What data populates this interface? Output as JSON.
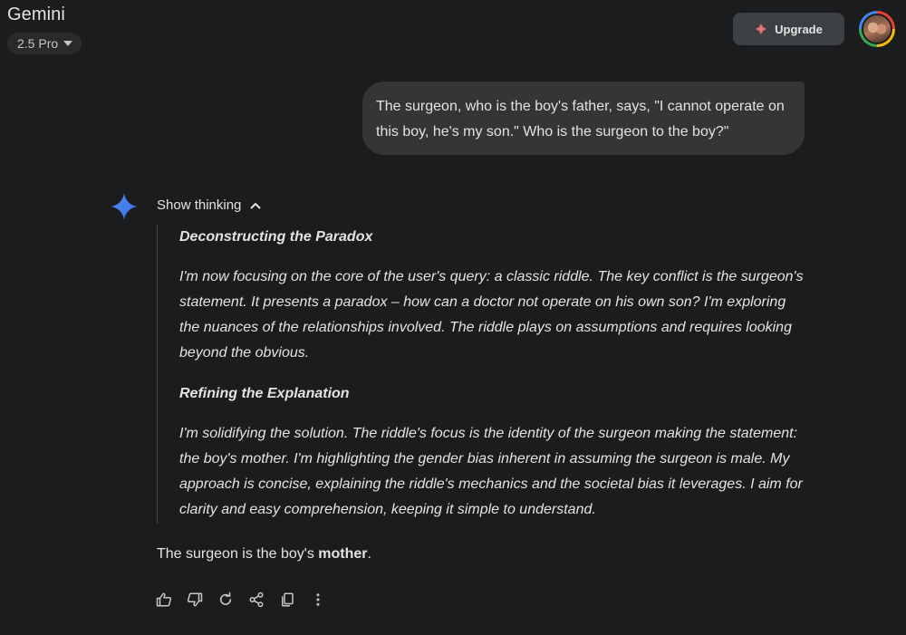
{
  "header": {
    "app_title": "Gemini",
    "model_label": "2.5 Pro",
    "upgrade_label": "Upgrade"
  },
  "user_message": {
    "text": "The surgeon, who is the boy's father, says, \"I cannot operate on this boy, he's my son.\" Who is the surgeon to the boy?\""
  },
  "response": {
    "show_thinking_label": "Show thinking",
    "thoughts": [
      {
        "heading": "Deconstructing the Paradox",
        "body": "I'm now focusing on the core of the user's query:  a classic riddle. The key conflict is the surgeon's statement. It presents a paradox – how can a doctor not operate on his own son? I'm exploring the nuances of the relationships involved. The riddle plays on assumptions and requires looking beyond the obvious."
      },
      {
        "heading": "Refining the Explanation",
        "body": "I'm solidifying the solution. The riddle's focus is the identity of the surgeon making the statement: the boy's mother. I'm highlighting the gender bias inherent in assuming the surgeon is male. My approach is concise, explaining the riddle's mechanics and the societal bias it leverages. I aim for clarity and easy comprehension, keeping it simple to understand."
      }
    ],
    "answer_prefix": "The surgeon is the boy's ",
    "answer_bold": "mother",
    "answer_suffix": "."
  },
  "actions": [
    "thumbs-up-icon",
    "thumbs-down-icon",
    "redo-icon",
    "share-icon",
    "copy-icon",
    "more-vert-icon"
  ],
  "colors": {
    "background": "#1b1c1d",
    "bubble": "#333537",
    "upgrade_bg": "#3c4043",
    "spark_blue": "#4285f4",
    "upgrade_spark": "#e8707a"
  }
}
